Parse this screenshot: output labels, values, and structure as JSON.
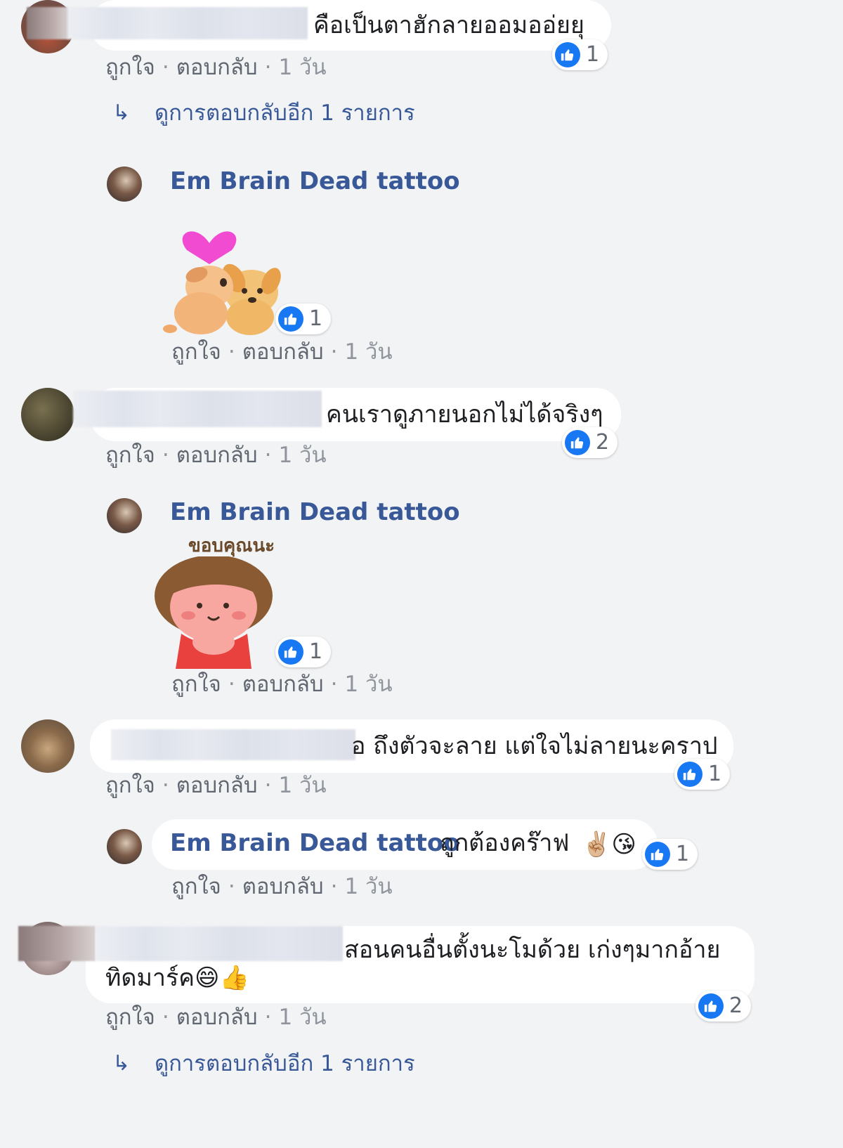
{
  "common": {
    "like": "ถูกใจ",
    "sep": "·",
    "reply": "ตอบกลับ",
    "time": "1 วัน"
  },
  "comments": [
    {
      "text": "คือเป็นตาฮักลายออมออ่ยยุ",
      "reactions": "1",
      "more_replies": "ดูการตอบกลับอีก 1 รายการ",
      "reply": {
        "author": "Em Brain Dead tattoo",
        "reactions": "1"
      }
    },
    {
      "text": "คนเราดูภายนอกไม่ได้จริงๆ",
      "reactions": "2",
      "reply": {
        "author": "Em Brain Dead tattoo",
        "sticker_caption": "ขอบคุณนะ",
        "reactions": "1"
      }
    },
    {
      "text": "อ ถึงตัวจะลาย แต่ใจไม่ลายนะคราป",
      "reactions": "1",
      "reply": {
        "author": "Em Brain Dead tattoo",
        "text": "ถูกต้องคร๊าฟ",
        "emoji": "✌🏼😘",
        "reactions": "1"
      }
    },
    {
      "text_line1": "สอนคนอื่นตั้งนะโมด้วย เก่งๆมากอ้าย",
      "text_line2": "ทิดมาร์ค",
      "emoji": "😄👍",
      "reactions": "2",
      "more_replies": "ดูการตอบกลับอีก 1 รายการ"
    }
  ]
}
